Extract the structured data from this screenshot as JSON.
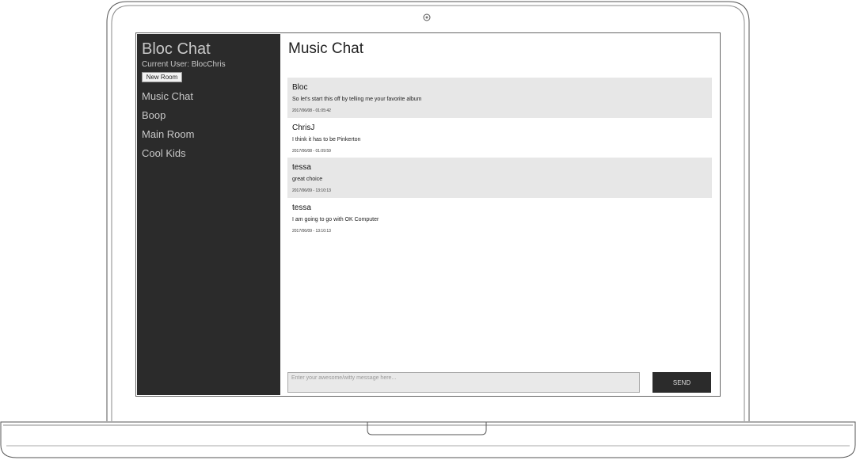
{
  "sidebar": {
    "brand": "Bloc Chat",
    "current_user": "Current User: BlocChris",
    "new_room_label": "New Room",
    "rooms": [
      "Music Chat",
      "Boop",
      "Main Room",
      "Cool Kids"
    ]
  },
  "main": {
    "room_title": "Music Chat",
    "messages": [
      {
        "username": "Bloc",
        "content": "So let's start this off by telling me your favorite album",
        "sent_at": "2017/06/08 - 01:05:42"
      },
      {
        "username": "ChrisJ",
        "content": "I think it has to be Pinkerton",
        "sent_at": "2017/06/08 - 01:09:59"
      },
      {
        "username": "tessa",
        "content": "great choice",
        "sent_at": "2017/06/09 - 13:10:13"
      },
      {
        "username": "tessa",
        "content": "I am going to go with OK Computer",
        "sent_at": "2017/06/09 - 13:10:13"
      }
    ],
    "composer_placeholder": "Enter your awesome/witty message here...",
    "send_label": "SEND"
  },
  "colors": {
    "sidebar_bg": "#2b2b2b",
    "sidebar_text": "#c8c8c8",
    "message_shade": "#e7e7e7",
    "send_button": "#2b2b2b"
  }
}
